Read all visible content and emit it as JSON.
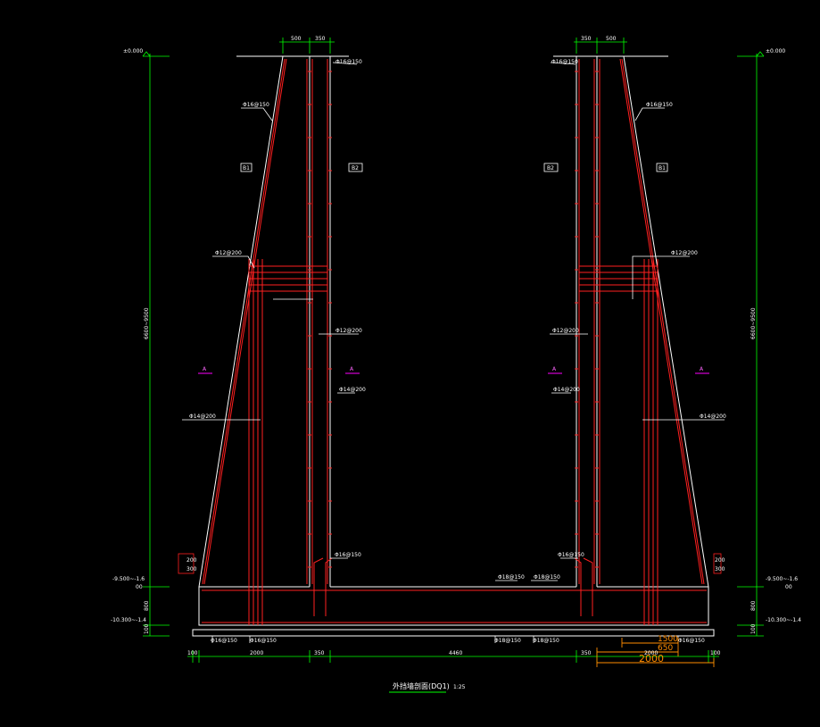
{
  "colors": {
    "background": "#000000",
    "concrete": "#ffffff",
    "rebar": "#ff2020",
    "dimension": "#00ff00",
    "highlight_dimension": "#ff8c00",
    "section_marker": "#ff00ff"
  },
  "elevations": {
    "top_left": "±0.000",
    "top_right": "±0.000",
    "mid_left": "-9.500~-1.6",
    "mid_right": "-9.500~-1.6",
    "bottom_left": "-10.300~-1.4",
    "bottom_right": "-10.300~-1.4",
    "sub_left": "00",
    "sub_right": "00"
  },
  "dimensions": {
    "wall_height_left": "6600~9500",
    "wall_height_right": "6600~9500",
    "wall_top_left_a": "500",
    "wall_top_left_b": "350",
    "wall_top_right_a": "350",
    "wall_top_right_b": "500",
    "bottom_chain": [
      "100",
      "2000",
      "350",
      "4460",
      "350",
      "2000",
      "100"
    ],
    "base_layers_left": [
      "800",
      "100"
    ],
    "base_layers_right": [
      "800",
      "100"
    ],
    "haunch_left": [
      "200",
      "300"
    ],
    "haunch_right": [
      "200",
      "300"
    ],
    "highlight": [
      "1500",
      "650",
      "2000"
    ]
  },
  "tags": {
    "tag_a1": "B1",
    "tag_a2": "B2",
    "tag_a3": "B2",
    "tag_a4": "B1",
    "section_mark": "A"
  },
  "rebar_labels": [
    "Φ16@150",
    "Φ16@150",
    "Φ16@150",
    "Φ16@150",
    "Φ12@200",
    "Φ12@200",
    "Φ12@200",
    "Φ12@200",
    "Φ14@200",
    "Φ14@200",
    "Φ14@200",
    "Φ14@200",
    "Φ16@150",
    "Φ16@150",
    "Φ18@150",
    "Φ18@150",
    "Φ16@150",
    "Φ16@150",
    "Φ18@150",
    "Φ18@150",
    "Φ16@150",
    "Φ16@150",
    "Φ16@150",
    "Φ16@150"
  ],
  "title": {
    "main": "外挡墙剖面(DQ1)",
    "scale": "1:25"
  }
}
